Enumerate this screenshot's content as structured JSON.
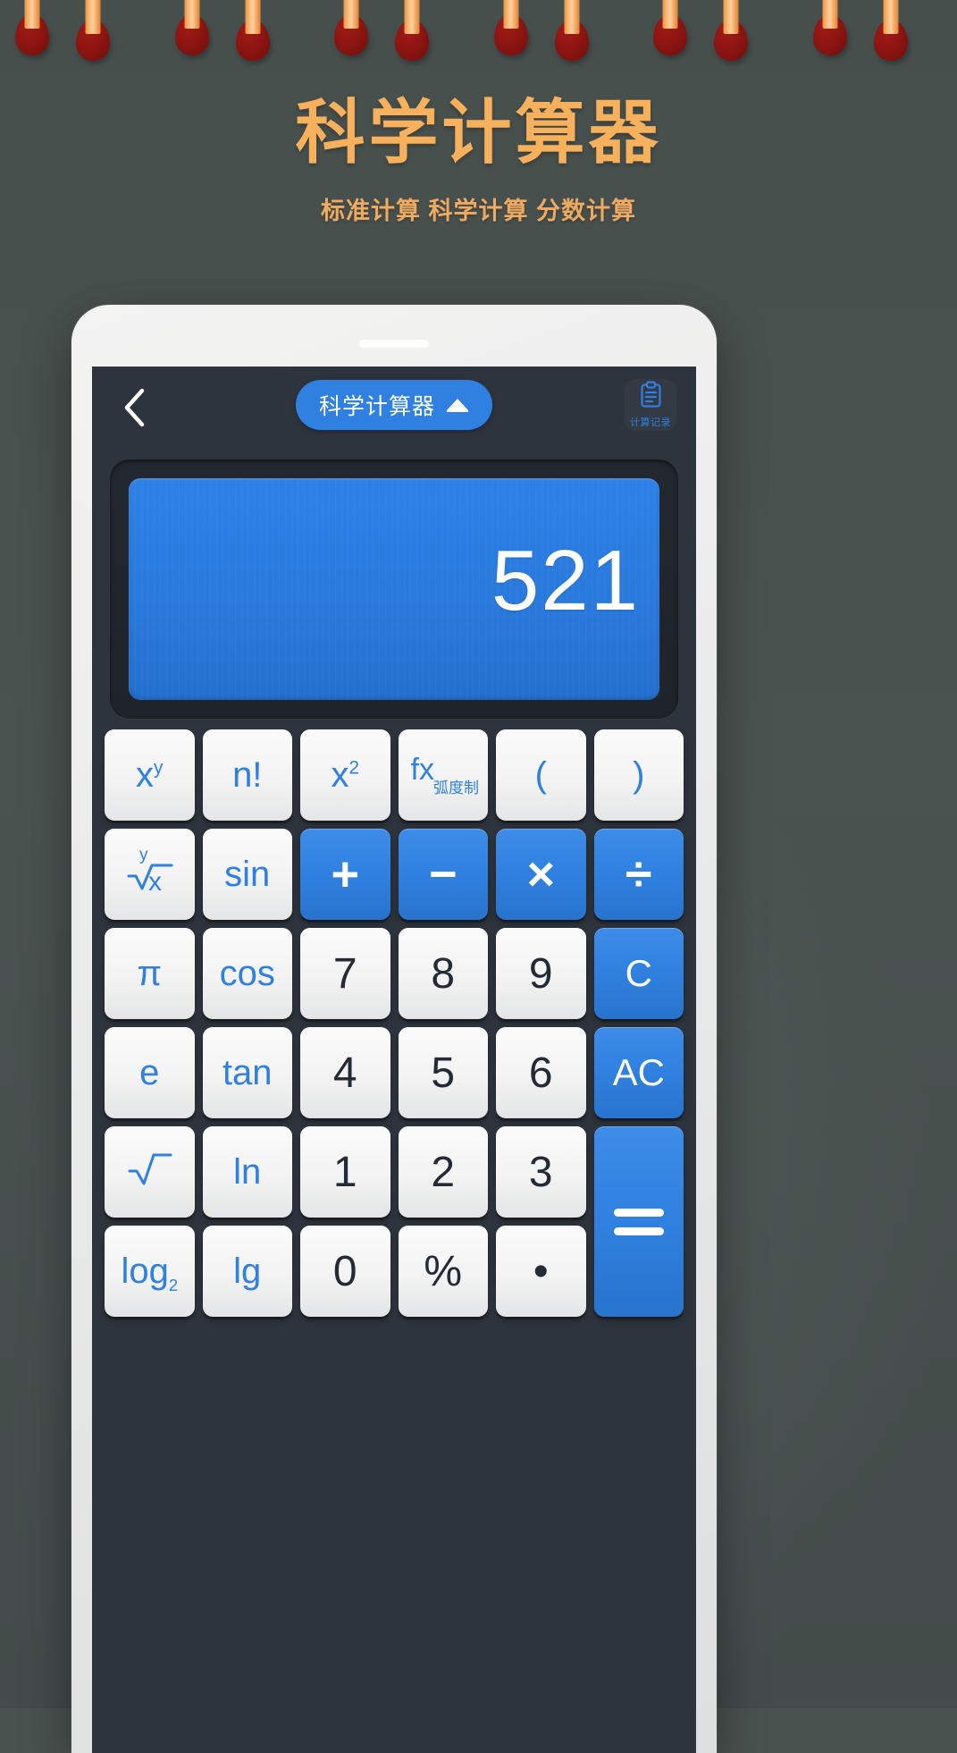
{
  "page": {
    "title": "科学计算器",
    "subtitle": "标准计算 科学计算 分数计算",
    "background_color": "#4a5250",
    "accent_color": "#f7b05b",
    "match_stick_color": "#fcb978",
    "match_head_color": "#8e1512",
    "match_count": 12
  },
  "app": {
    "back_icon": "chevron-left-icon",
    "mode": {
      "label": "科学计算器",
      "caret_icon": "triangle-up-icon",
      "pill_color": "#2f80e0"
    },
    "history": {
      "icon": "clipboard-icon",
      "label": "计算记录",
      "color": "#2f80e0"
    },
    "display": {
      "value": "521",
      "screen_color": "#2a79dd",
      "text_color": "#ffffff"
    },
    "keypad": {
      "digit_color": "#242b36",
      "function_color": "#2f80e0",
      "operator_color": "#2f80e0",
      "rows": [
        [
          {
            "name": "x-power-y",
            "text": "x",
            "sup": "y",
            "style": "light"
          },
          {
            "name": "factorial",
            "text": "n!",
            "style": "light"
          },
          {
            "name": "x-squared",
            "text": "x",
            "sup": "2",
            "style": "light"
          },
          {
            "name": "fx-radian",
            "text": "fx",
            "sub_label": "弧度制",
            "style": "light",
            "kind": "fx"
          },
          {
            "name": "paren-open",
            "text": "(",
            "style": "light"
          },
          {
            "name": "paren-close",
            "text": ")",
            "style": "light"
          }
        ],
        [
          {
            "name": "y-root-x",
            "text": "x",
            "index": "y",
            "style": "light",
            "kind": "root"
          },
          {
            "name": "sin",
            "text": "sin",
            "style": "light"
          },
          {
            "name": "plus",
            "text": "+",
            "style": "blue",
            "kind": "op"
          },
          {
            "name": "minus",
            "text": "−",
            "style": "blue",
            "kind": "op"
          },
          {
            "name": "multiply",
            "text": "×",
            "style": "blue",
            "kind": "op"
          },
          {
            "name": "divide",
            "text": "÷",
            "style": "blue",
            "kind": "op"
          }
        ],
        [
          {
            "name": "pi",
            "text": "π",
            "style": "light"
          },
          {
            "name": "cos",
            "text": "cos",
            "style": "light"
          },
          {
            "name": "digit-7",
            "text": "7",
            "style": "digit"
          },
          {
            "name": "digit-8",
            "text": "8",
            "style": "digit"
          },
          {
            "name": "digit-9",
            "text": "9",
            "style": "digit"
          },
          {
            "name": "clear-entry",
            "text": "C",
            "style": "blue"
          }
        ],
        [
          {
            "name": "euler-e",
            "text": "e",
            "style": "light"
          },
          {
            "name": "tan",
            "text": "tan",
            "style": "light"
          },
          {
            "name": "digit-4",
            "text": "4",
            "style": "digit"
          },
          {
            "name": "digit-5",
            "text": "5",
            "style": "digit"
          },
          {
            "name": "digit-6",
            "text": "6",
            "style": "digit"
          },
          {
            "name": "all-clear",
            "text": "AC",
            "style": "blue"
          }
        ],
        [
          {
            "name": "square-root",
            "text": "√",
            "style": "light"
          },
          {
            "name": "natural-log",
            "text": "ln",
            "style": "light"
          },
          {
            "name": "digit-1",
            "text": "1",
            "style": "digit"
          },
          {
            "name": "digit-2",
            "text": "2",
            "style": "digit"
          },
          {
            "name": "digit-3",
            "text": "3",
            "style": "digit"
          },
          {
            "name": "equals",
            "text": "=",
            "style": "blue",
            "kind": "equals",
            "tall": true
          }
        ],
        [
          {
            "name": "log-base-2",
            "text": "log",
            "sub": "2",
            "style": "light"
          },
          {
            "name": "log-base-10",
            "text": "lg",
            "style": "light"
          },
          {
            "name": "digit-0",
            "text": "0",
            "style": "digit"
          },
          {
            "name": "percent",
            "text": "%",
            "style": "digit"
          },
          {
            "name": "decimal-point",
            "text": "•",
            "style": "digit"
          }
        ]
      ]
    }
  }
}
